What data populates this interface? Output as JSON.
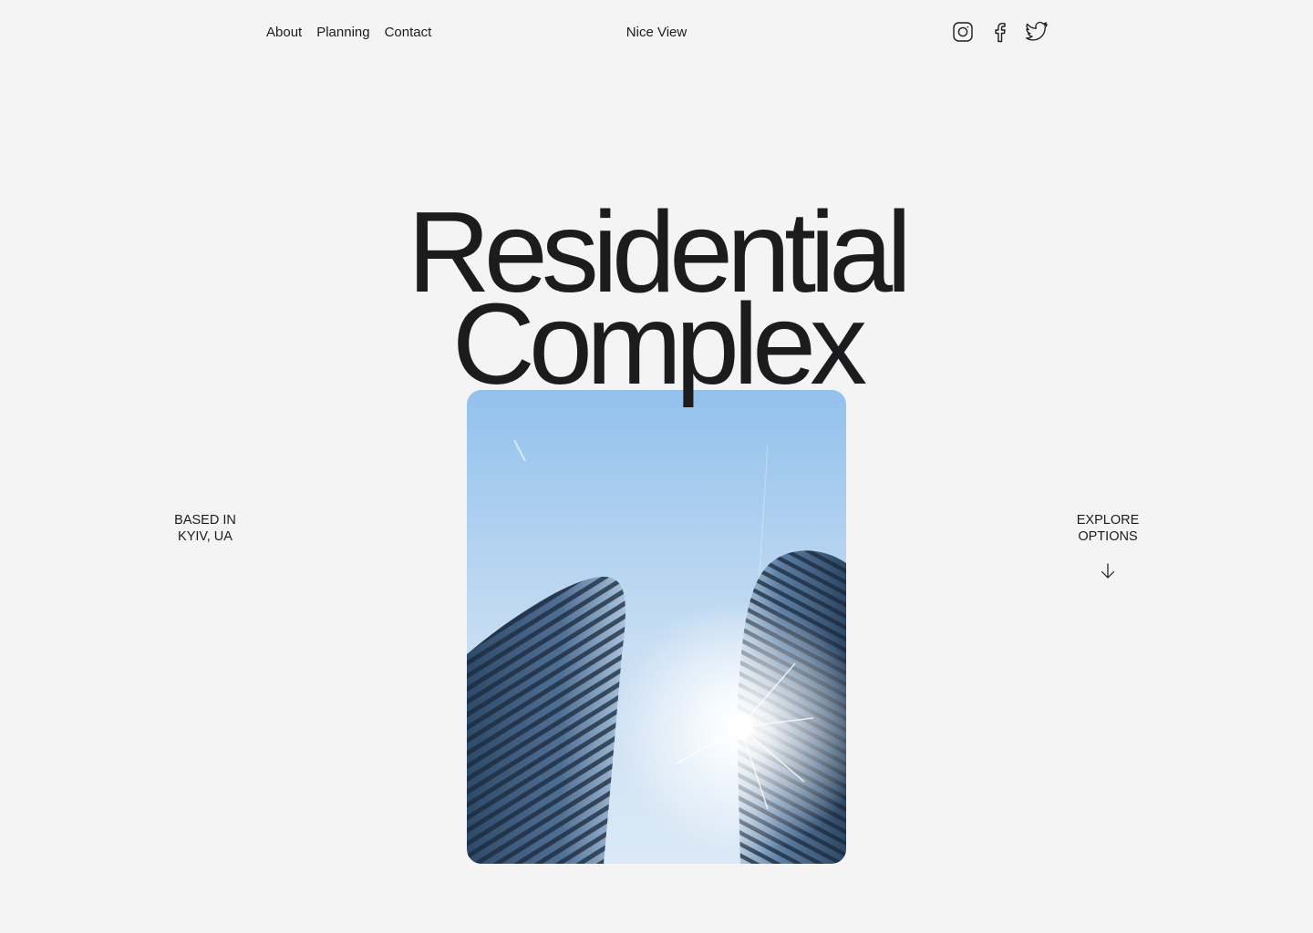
{
  "nav": {
    "items": [
      {
        "label": "About"
      },
      {
        "label": "Planning"
      },
      {
        "label": "Contact"
      }
    ]
  },
  "brand": {
    "name": "Nice View"
  },
  "socials": [
    {
      "icon": "instagram-icon"
    },
    {
      "icon": "facebook-icon"
    },
    {
      "icon": "twitter-icon"
    }
  ],
  "hero": {
    "title_line1": "Residential",
    "title_line2": "Complex"
  },
  "location": {
    "line1": "BASED IN",
    "line2": "KYIV, UA"
  },
  "explore": {
    "line1": "EXPLORE",
    "line2": "OPTIONS",
    "icon": "arrow-down-icon"
  },
  "colors": {
    "background": "#f4f4f4",
    "text": "#1c1c1e",
    "sky_top": "#93c2ec",
    "sky_bottom": "#d9e8f6"
  }
}
